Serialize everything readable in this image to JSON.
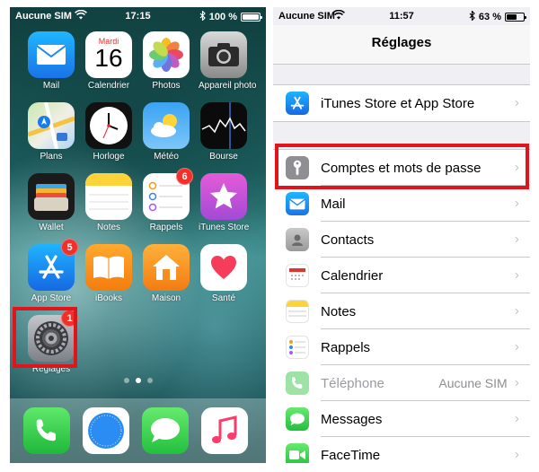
{
  "left_phone": {
    "status": {
      "carrier": "Aucune SIM",
      "time": "17:15",
      "battery": "100 %",
      "battery_level": 1.0
    },
    "apps": [
      {
        "label": "Mail",
        "icon": "mail-icon"
      },
      {
        "label": "Calendrier",
        "icon": "calendar-icon",
        "day_name": "Mardi",
        "day_number": "16"
      },
      {
        "label": "Photos",
        "icon": "photos-icon"
      },
      {
        "label": "Appareil photo",
        "icon": "camera-icon"
      },
      {
        "label": "Plans",
        "icon": "maps-icon"
      },
      {
        "label": "Horloge",
        "icon": "clock-icon"
      },
      {
        "label": "Météo",
        "icon": "weather-icon"
      },
      {
        "label": "Bourse",
        "icon": "stocks-icon"
      },
      {
        "label": "Wallet",
        "icon": "wallet-icon"
      },
      {
        "label": "Notes",
        "icon": "notes-icon"
      },
      {
        "label": "Rappels",
        "icon": "reminders-icon",
        "badge": "6"
      },
      {
        "label": "iTunes Store",
        "icon": "itunes-star-icon"
      },
      {
        "label": "App Store",
        "icon": "app-store-icon",
        "badge": "5"
      },
      {
        "label": "iBooks",
        "icon": "ibooks-icon"
      },
      {
        "label": "Maison",
        "icon": "home-icon"
      },
      {
        "label": "Santé",
        "icon": "health-icon"
      },
      {
        "label": "Réglages",
        "icon": "settings-gear-icon",
        "badge": "1"
      }
    ],
    "dock": [
      {
        "icon": "phone-icon"
      },
      {
        "icon": "safari-icon"
      },
      {
        "icon": "messages-icon"
      },
      {
        "icon": "music-icon"
      }
    ]
  },
  "right_phone": {
    "status": {
      "carrier": "Aucune SIM",
      "time": "11:57",
      "battery": "63 %",
      "battery_level": 0.63
    },
    "title": "Réglages",
    "group1": [
      {
        "label": "iTunes Store et App Store",
        "icon": "app-store-icon"
      }
    ],
    "group2": [
      {
        "label": "Comptes et mots de passe",
        "icon": "key-icon"
      },
      {
        "label": "Mail",
        "icon": "mail-icon"
      },
      {
        "label": "Contacts",
        "icon": "contacts-icon"
      },
      {
        "label": "Calendrier",
        "icon": "calendar-icon"
      },
      {
        "label": "Notes",
        "icon": "notes-icon"
      },
      {
        "label": "Rappels",
        "icon": "reminders-icon"
      },
      {
        "label": "Téléphone",
        "icon": "phone-icon",
        "value": "Aucune SIM"
      },
      {
        "label": "Messages",
        "icon": "messages-icon"
      },
      {
        "label": "FaceTime",
        "icon": "facetime-icon"
      }
    ]
  },
  "colors": {
    "highlight": "#e1141c",
    "badge": "#f0302b",
    "ios_blue": "#1e90ff",
    "ios_green": "#34c759"
  }
}
